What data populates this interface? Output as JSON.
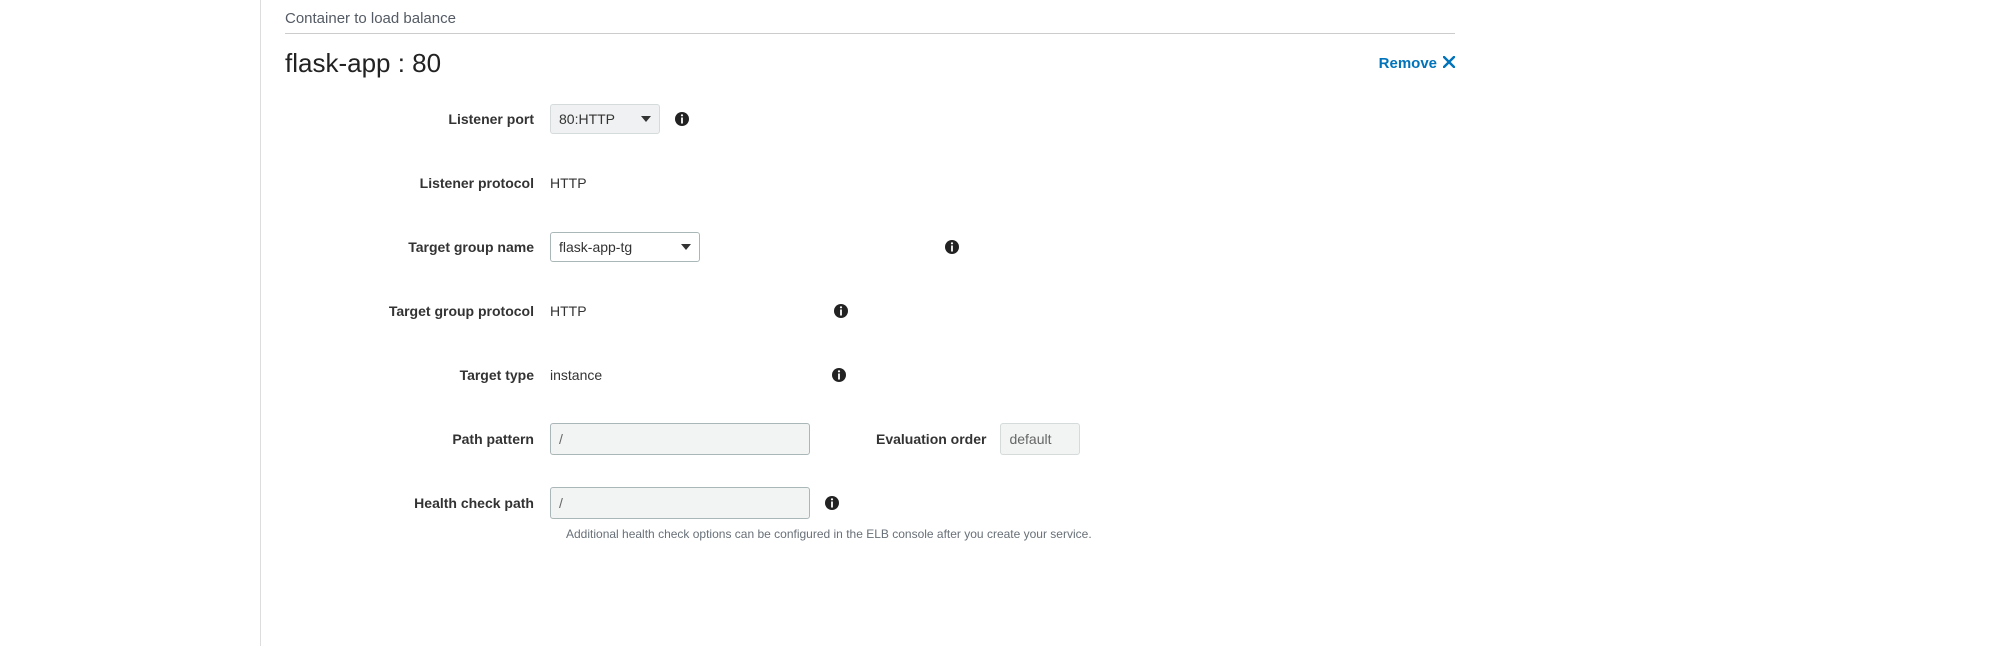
{
  "section_title": "Container to load balance",
  "container_heading": "flask-app : 80",
  "remove_label": "Remove",
  "fields": {
    "listener_port": {
      "label": "Listener port",
      "value": "80:HTTP"
    },
    "listener_protocol": {
      "label": "Listener protocol",
      "value": "HTTP"
    },
    "target_group_name": {
      "label": "Target group name",
      "value": "flask-app-tg"
    },
    "target_group_protocol": {
      "label": "Target group protocol",
      "value": "HTTP"
    },
    "target_type": {
      "label": "Target type",
      "value": "instance"
    },
    "path_pattern": {
      "label": "Path pattern",
      "value": "/"
    },
    "evaluation_order": {
      "label": "Evaluation order",
      "value": "default"
    },
    "health_check_path": {
      "label": "Health check path",
      "value": "/"
    }
  },
  "help_text": "Additional health check options can be configured in the ELB console after you create your service."
}
